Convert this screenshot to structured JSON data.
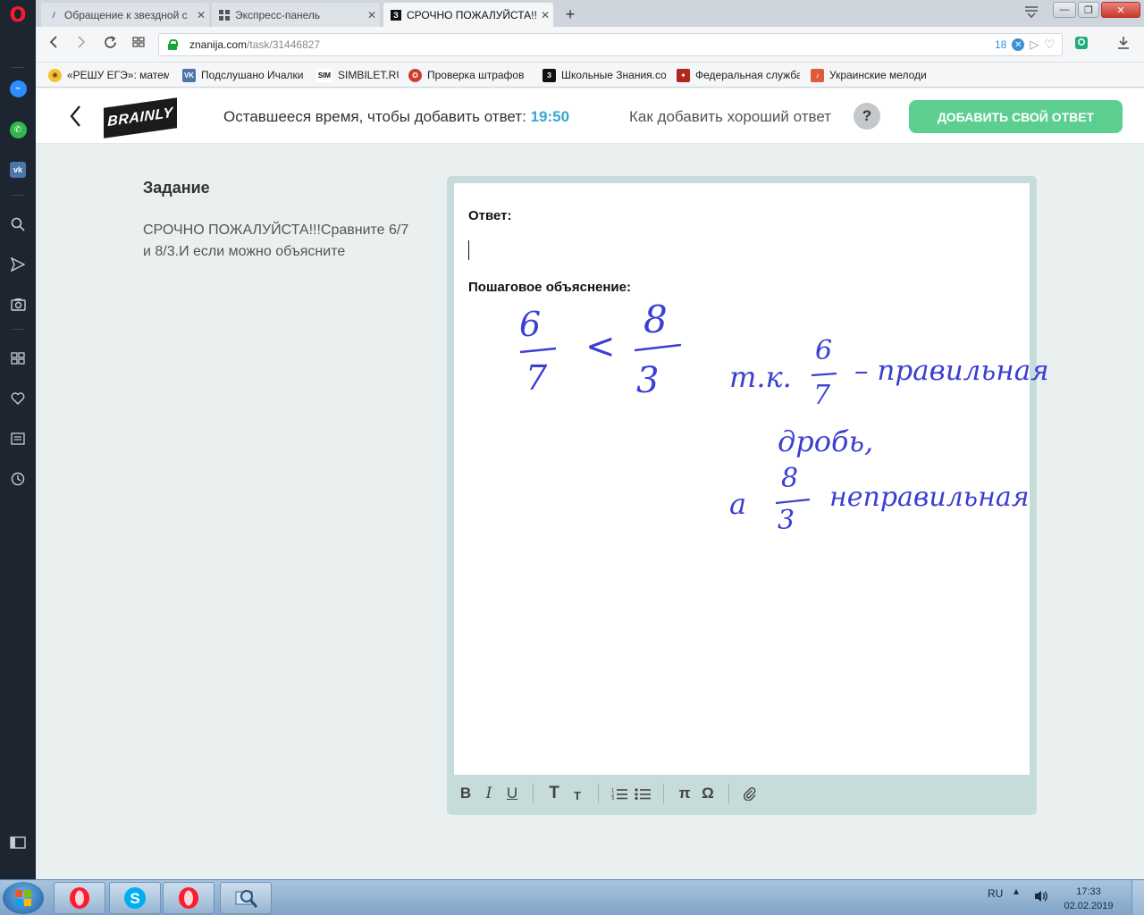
{
  "browser": {
    "tabs": [
      {
        "title": "Обращение к звездной с",
        "active": false
      },
      {
        "title": "Экспресс-панель",
        "active": false
      },
      {
        "title": "СРОЧНО ПОЖАЛУЙСТА!!!",
        "active": true
      }
    ],
    "url_domain": "znanija.com",
    "url_path": "/task/31446827",
    "adblock_count": "18",
    "bookmarks": [
      {
        "label": "«РЕШУ ЕГЭ»: матема"
      },
      {
        "label": "Подслушано Ичалки",
        "fav": "VK"
      },
      {
        "label": "SIMBILET.RU",
        "fav": "SIM"
      },
      {
        "label": "Проверка штрафов"
      },
      {
        "label": "Школьные Знания.co",
        "fav": "З"
      },
      {
        "label": "Федеральная служба"
      },
      {
        "label": "Украинские мелоди"
      }
    ]
  },
  "header": {
    "logo_text": "BRAINLY",
    "timer_label": "Оставшееся время, чтобы добавить ответ:",
    "timer_value": "19:50",
    "howto_label": "Как добавить хороший ответ",
    "help_symbol": "?",
    "add_answer_label": "ДОБАВИТЬ СВОЙ ОТВЕТ"
  },
  "task": {
    "title": "Задание",
    "text": "СРОЧНО ПОЖАЛУЙСТА!!!Сравните 6/7 и 8/3.И если можно объясните"
  },
  "editor": {
    "answer_label": "Ответ:",
    "explanation_label": "Пошаговое объяснение:",
    "handwriting": {
      "frac1_num": "6",
      "frac1_den": "7",
      "sign": "<",
      "frac2_num": "8",
      "frac2_den": "3",
      "line1_prefix": "т.к.",
      "line1_frac_num": "6",
      "line1_frac_den": "7",
      "line1_text": "– правильная",
      "line2_text": "дробь,",
      "line3_prefix": "а",
      "line3_frac_num": "8",
      "line3_frac_den": "3",
      "line3_text": "неправильная"
    },
    "toolbar": {
      "bold": "B",
      "italic": "I",
      "underline": "U",
      "heading_large": "T",
      "heading_small": "T",
      "pi": "π",
      "omega": "Ω"
    }
  },
  "taskbar": {
    "lang": "RU",
    "time": "17:33",
    "date": "02.02.2019"
  },
  "colors": {
    "brand_green": "#5ccf90",
    "timer_blue": "#3aa6d6",
    "handwriting_blue": "#3b3fd2",
    "editor_frame": "#c6dcdb"
  }
}
